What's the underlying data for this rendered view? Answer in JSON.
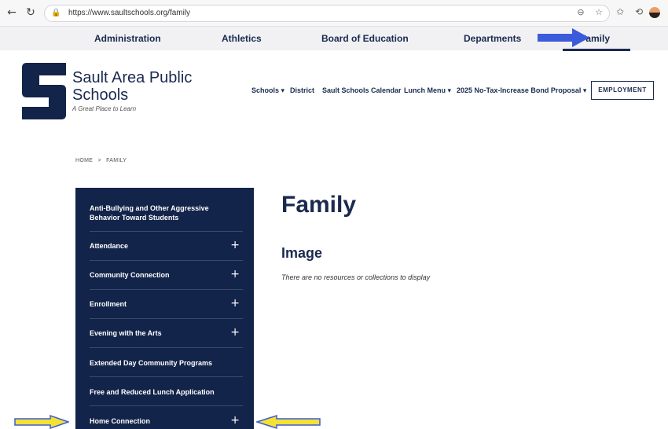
{
  "browser": {
    "url": "https://www.saultschools.org/family"
  },
  "topnav": {
    "items": [
      "Administration",
      "Athletics",
      "Board of Education",
      "Departments",
      "Family"
    ]
  },
  "header": {
    "school_name_line1": "Sault Area Public",
    "school_name_line2": "Schools",
    "tagline": "A Great Place to Learn",
    "nav": [
      "Schools ▾",
      "District",
      "Sault Schools Calendar",
      "Lunch Menu ▾",
      "2025 No-Tax-Increase Bond Proposal ▾"
    ],
    "employment_label": "EMPLOYMENT"
  },
  "breadcrumb": {
    "home": "HOME",
    "separator": ">",
    "current": "FAMILY"
  },
  "sidebar": {
    "items": [
      {
        "label": "Anti-Bullying and Other Aggressive Behavior Toward Students",
        "expandable": false
      },
      {
        "label": "Attendance",
        "expandable": true
      },
      {
        "label": "Community Connection",
        "expandable": true
      },
      {
        "label": "Enrollment",
        "expandable": true
      },
      {
        "label": "Evening with the Arts",
        "expandable": true
      },
      {
        "label": "Extended Day Community Programs",
        "expandable": false
      },
      {
        "label": "Free and Reduced Lunch Application",
        "expandable": false
      },
      {
        "label": "Home Connection",
        "expandable": true
      }
    ],
    "plus_glyph": "+"
  },
  "content": {
    "page_title": "Family",
    "section_title": "Image",
    "empty_message": "There are no resources or collections to display"
  },
  "colors": {
    "navy": "#13244a",
    "annotation_blue": "#3b5bdb",
    "annotation_yellow": "#f5e132"
  }
}
